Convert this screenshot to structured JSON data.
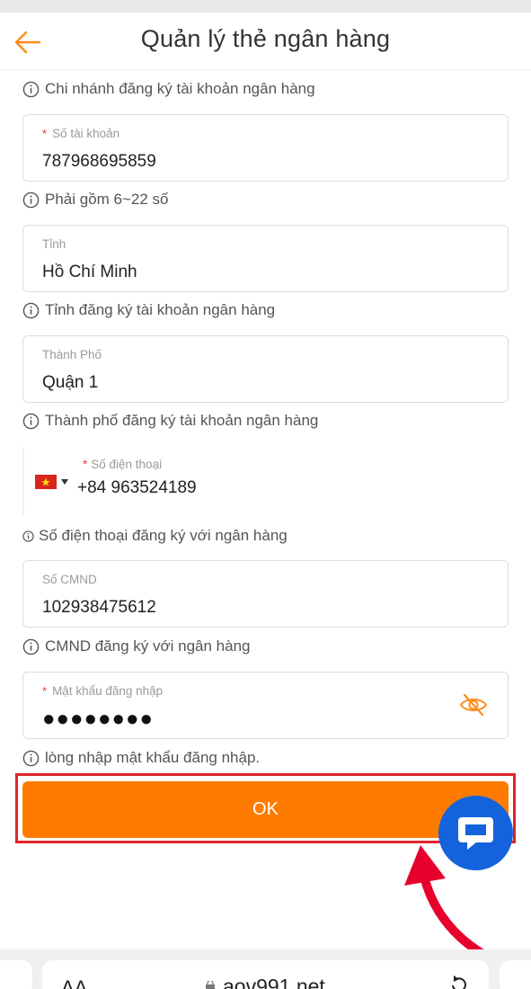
{
  "header": {
    "title": "Quản lý thẻ ngân hàng"
  },
  "hints": {
    "branch": "Chi nhánh đăng ký tài khoản ngân hàng",
    "account": "Phải gồm 6~22 số",
    "province": "Tỉnh đăng ký tài khoản ngân hàng",
    "city": "Thành phố đăng ký tài khoản ngân hàng",
    "phone": "Số điện thoại đăng ký với ngân hàng",
    "idcard": "CMND đăng ký với ngân hàng",
    "password": "lòng nhập mật khẩu đăng nhập."
  },
  "fields": {
    "account": {
      "required": "*",
      "label": "Số tài khoản",
      "value": "787968695859"
    },
    "province": {
      "label": "Tỉnh",
      "value": "Hồ Chí Minh"
    },
    "city": {
      "label": "Thành Phố",
      "value": "Quận 1"
    },
    "phone": {
      "required": "*",
      "label": "Số điện thoại",
      "value": "+84 963524189"
    },
    "idcard": {
      "label": "Số CMND",
      "value": "102938475612"
    },
    "password": {
      "required": "*",
      "label": "Mật khẩu đăng nhập",
      "value": "●●●●●●●●"
    }
  },
  "ok_button": {
    "label": "OK"
  },
  "browser": {
    "aa": "AA",
    "url": "aov991.net"
  },
  "colors": {
    "accent": "#ff7b00",
    "highlight": "#e0242b",
    "chat": "#1463dd",
    "arrow": "#e8002d"
  },
  "icons": {
    "back": "arrow-left-icon",
    "info": "info-circle-icon",
    "eye": "eye-slash-icon",
    "chat": "chat-bubble-icon",
    "flag": "vietnam-flag-icon",
    "lock": "lock-icon",
    "reload": "reload-icon"
  }
}
